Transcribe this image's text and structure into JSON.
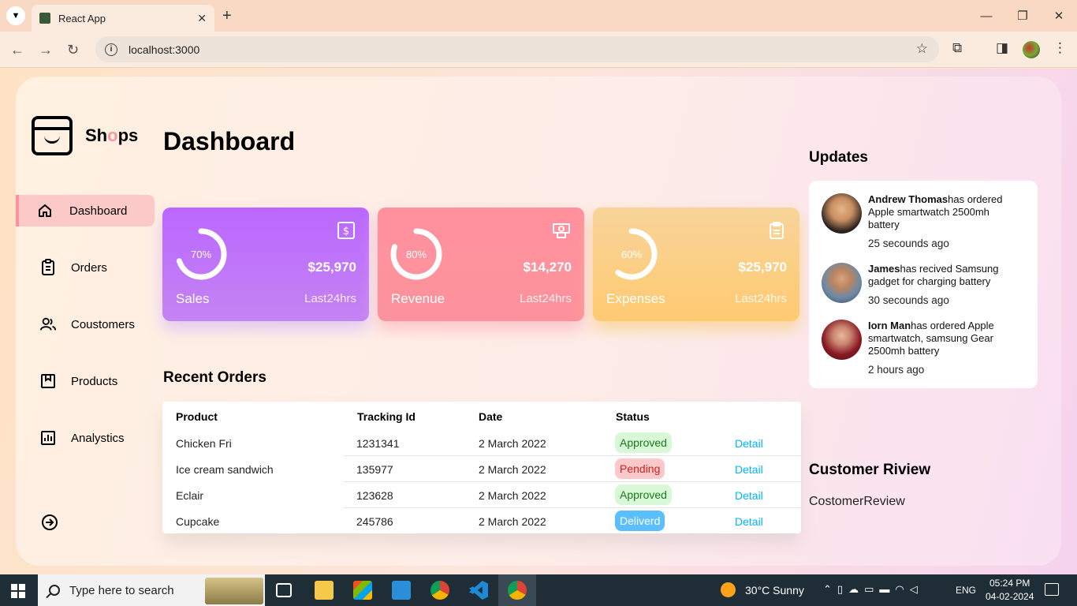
{
  "browser": {
    "tab_title": "React App",
    "url": "localhost:3000"
  },
  "sidebar": {
    "logo_text_start": "Sh",
    "logo_text_mid": "o",
    "logo_text_end": "ps",
    "items": [
      {
        "label": "Dashboard"
      },
      {
        "label": "Orders"
      },
      {
        "label": "Coustomers"
      },
      {
        "label": "Products"
      },
      {
        "label": "Analystics"
      }
    ]
  },
  "main": {
    "title": "Dashboard",
    "cards": [
      {
        "name": "Sales",
        "percent_label": "70%",
        "percent": 70,
        "amount": "$25,970",
        "period": "Last24hrs"
      },
      {
        "name": "Revenue",
        "percent_label": "80%",
        "percent": 80,
        "amount": "$14,270",
        "period": "Last24hrs"
      },
      {
        "name": "Expenses",
        "percent_label": "60%",
        "percent": 60,
        "amount": "$25,970",
        "period": "Last24hrs"
      }
    ],
    "recent_orders": {
      "title": "Recent Orders",
      "headers": [
        "Product",
        "Tracking Id",
        "Date",
        "Status"
      ],
      "rows": [
        {
          "product": "Chicken Fri",
          "tracking": "1231341",
          "date": "2 March 2022",
          "status": "Approved",
          "action": "Detail"
        },
        {
          "product": "Ice cream sandwich",
          "tracking": "135977",
          "date": "2 March 2022",
          "status": "Pending",
          "action": "Detail"
        },
        {
          "product": "Eclair",
          "tracking": "123628",
          "date": "2 March 2022",
          "status": "Approved",
          "action": "Detail"
        },
        {
          "product": "Cupcake",
          "tracking": "245786",
          "date": "2 March 2022",
          "status": "Deliverd",
          "action": "Detail"
        }
      ]
    }
  },
  "rightside": {
    "updates_title": "Updates",
    "updates": [
      {
        "name": "Andrew Thomas",
        "text": "has ordered Apple smartwatch 2500mh battery",
        "time": "25 secounds ago"
      },
      {
        "name": "James",
        "text": "has recived Samsung gadget for charging battery",
        "time": "30 secounds ago"
      },
      {
        "name": "Iorn Man",
        "text": "has ordered Apple smartwatch, samsung Gear 2500mh battery",
        "time": "2 hours ago"
      }
    ],
    "review_title": "Customer Riview",
    "review_text": "CostomerReview"
  },
  "taskbar": {
    "search_placeholder": "Type here to search",
    "weather": "30°C  Sunny",
    "language": "ENG",
    "time": "05:24 PM",
    "date": "04-02-2024"
  },
  "colors": {
    "sales": "#bb67ff",
    "revenue": "#ff919d",
    "expenses": "#ffca71",
    "approved": "#d8f8d8",
    "pending": "#fbc9c9",
    "delivered": "#59bfff",
    "detail": "#00b5ff"
  }
}
